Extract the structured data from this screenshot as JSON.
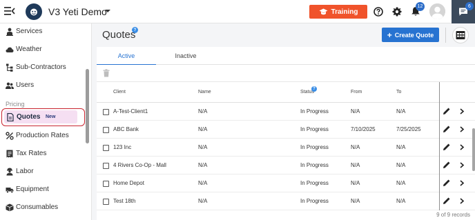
{
  "header": {
    "org_name": "V3 Yeti Demo",
    "training_label": "Training",
    "notification_count": "12",
    "chat_count": "6",
    "accent_color": "#f0532b"
  },
  "sidebar": {
    "items_top": [
      {
        "label": "Services",
        "icon": "person-pin-icon"
      },
      {
        "label": "Weather",
        "icon": "cloud-icon"
      },
      {
        "label": "Sub-Contractors",
        "icon": "hierarchy-icon"
      },
      {
        "label": "Users",
        "icon": "users-icon"
      }
    ],
    "section_label": "Pricing",
    "active_item": {
      "label": "Quotes",
      "badge": "New",
      "icon": "document-icon"
    },
    "items_bottom": [
      {
        "label": "Production Rates",
        "icon": "percent-icon"
      },
      {
        "label": "Tax Rates",
        "icon": "receipt-icon"
      },
      {
        "label": "Labor",
        "icon": "worker-icon"
      },
      {
        "label": "Equipment",
        "icon": "truck-icon"
      },
      {
        "label": "Consumables",
        "icon": "box-icon"
      }
    ]
  },
  "page": {
    "title": "Quotes",
    "create_label": "Create Quote",
    "tabs": [
      {
        "label": "Active",
        "active": true
      },
      {
        "label": "Inactive",
        "active": false
      }
    ]
  },
  "table": {
    "columns": {
      "client": "Client",
      "name": "Name",
      "status": "Status",
      "from": "From",
      "to": "To"
    },
    "rows": [
      {
        "client": "A-Test-Client1",
        "name": "N/A",
        "status": "In Progress",
        "from": "N/A",
        "to": "N/A"
      },
      {
        "client": "ABC Bank",
        "name": "N/A",
        "status": "In Progress",
        "from": "7/10/2025",
        "to": "7/25/2025"
      },
      {
        "client": "123 Inc",
        "name": "N/A",
        "status": "In Progress",
        "from": "N/A",
        "to": "N/A"
      },
      {
        "client": "4 Rivers Co-Op - Mall",
        "name": "N/A",
        "status": "In Progress",
        "from": "N/A",
        "to": "N/A"
      },
      {
        "client": "Home Depot",
        "name": "N/A",
        "status": "In Progress",
        "from": "N/A",
        "to": "N/A"
      },
      {
        "client": "Test 18th",
        "name": "N/A",
        "status": "In Progress",
        "from": "N/A",
        "to": "N/A"
      }
    ],
    "records_label": "9 of 9 records"
  }
}
